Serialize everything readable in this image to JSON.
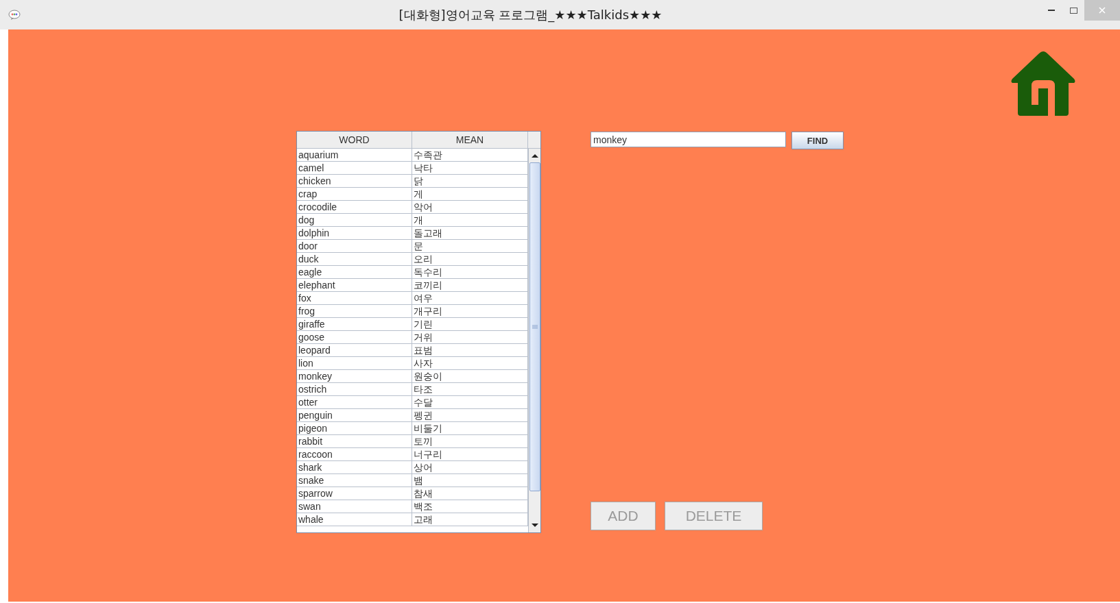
{
  "window": {
    "title": "[대화형]영어교육 프로그램_★★★Talkids★★★"
  },
  "table": {
    "columns": [
      "WORD",
      "MEAN"
    ],
    "rows": [
      [
        "aquarium",
        "수족관"
      ],
      [
        "camel",
        "낙타"
      ],
      [
        "chicken",
        "닭"
      ],
      [
        "crap",
        "게"
      ],
      [
        "crocodile",
        "악어"
      ],
      [
        "dog",
        "개"
      ],
      [
        "dolphin",
        "돌고래"
      ],
      [
        "door",
        "문"
      ],
      [
        "duck",
        "오리"
      ],
      [
        "eagle",
        "독수리"
      ],
      [
        "elephant",
        "코끼리"
      ],
      [
        "fox",
        "여우"
      ],
      [
        "frog",
        "개구리"
      ],
      [
        "giraffe",
        "기린"
      ],
      [
        "goose",
        "거위"
      ],
      [
        "leopard",
        "표범"
      ],
      [
        "lion",
        "사자"
      ],
      [
        "monkey",
        "원숭이"
      ],
      [
        "ostrich",
        "타조"
      ],
      [
        "otter",
        "수달"
      ],
      [
        "penguin",
        "펭귄"
      ],
      [
        "pigeon",
        "비둘기"
      ],
      [
        "rabbit",
        "토끼"
      ],
      [
        "raccoon",
        "너구리"
      ],
      [
        "shark",
        "상어"
      ],
      [
        "snake",
        "뱀"
      ],
      [
        "sparrow",
        "참새"
      ],
      [
        "swan",
        "백조"
      ],
      [
        "whale",
        "고래"
      ]
    ]
  },
  "search": {
    "value": "monkey",
    "button": "FIND"
  },
  "actions": [
    {
      "label": "ADD",
      "disabled": true
    },
    {
      "label": "DELETE",
      "disabled": true
    }
  ]
}
